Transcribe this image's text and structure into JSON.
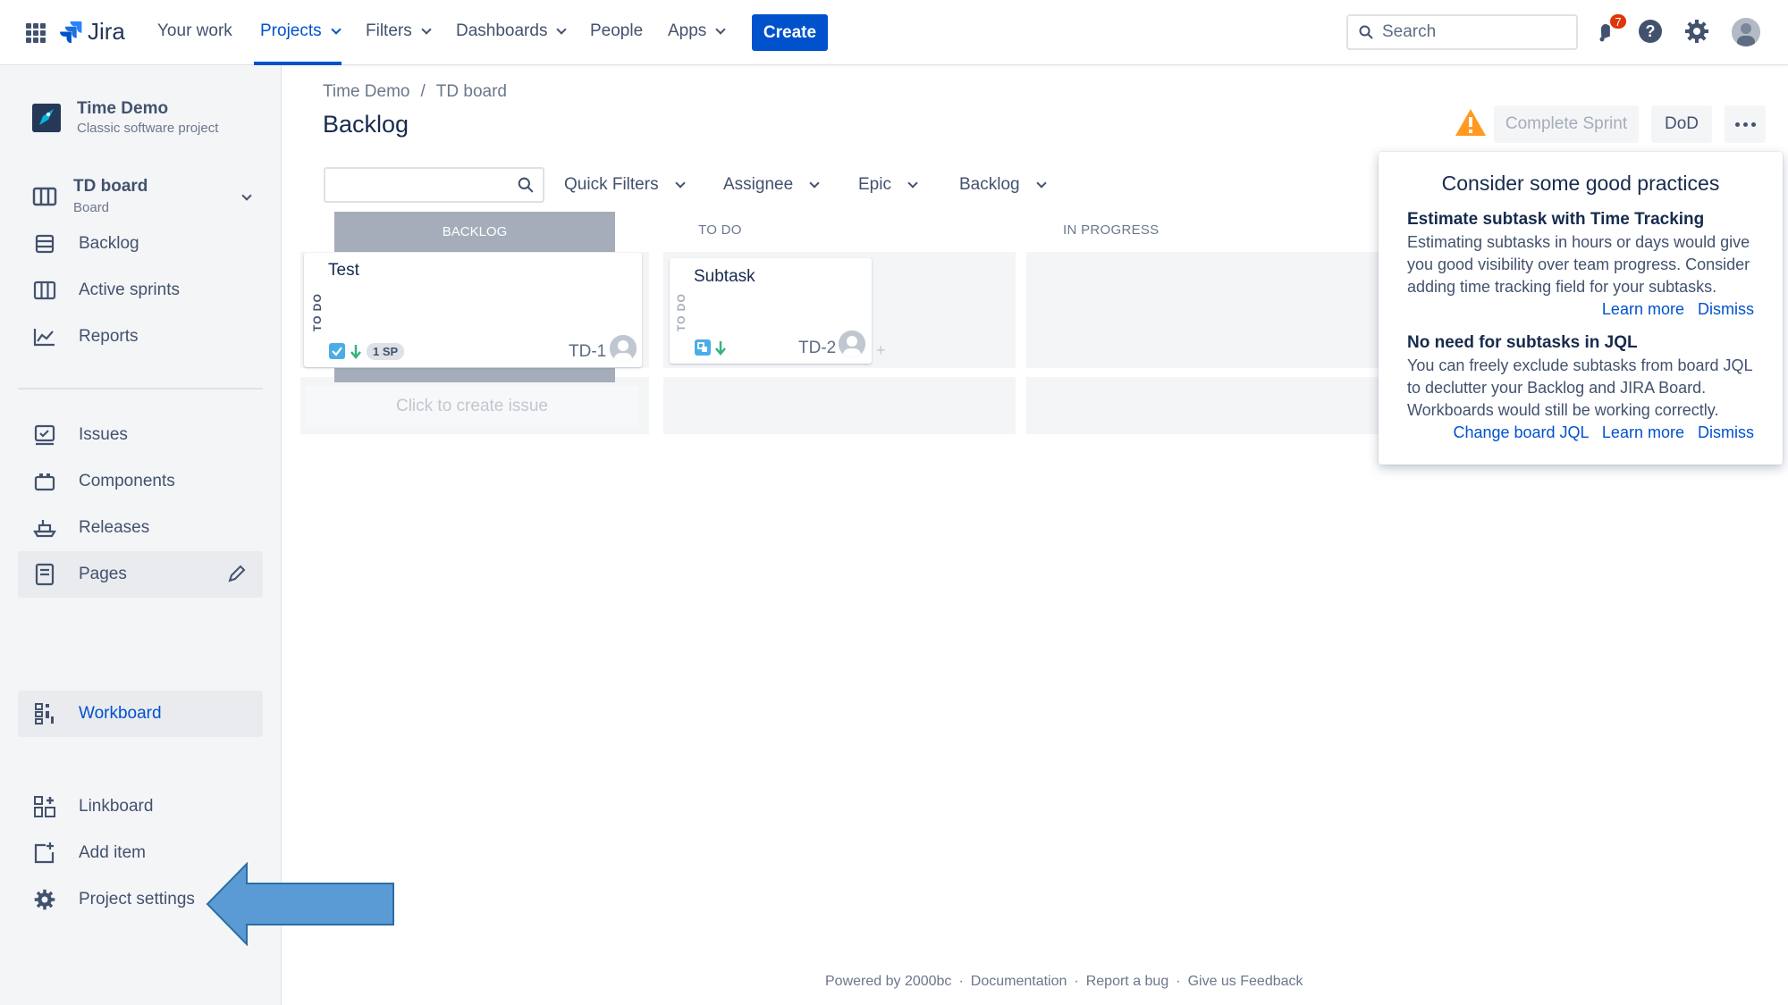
{
  "topnav": {
    "logo": "Jira",
    "items": [
      {
        "label": "Your work"
      },
      {
        "label": "Projects"
      },
      {
        "label": "Filters"
      },
      {
        "label": "Dashboards"
      },
      {
        "label": "People"
      },
      {
        "label": "Apps"
      }
    ],
    "create_label": "Create",
    "search_placeholder": "Search",
    "notification_count": "7",
    "accent": "#0052cc"
  },
  "sidebar": {
    "project_name": "Time Demo",
    "project_type": "Classic software project",
    "board_name": "TD board",
    "board_sub": "Board",
    "items": [
      {
        "label": "Backlog",
        "icon": "backlog-icon"
      },
      {
        "label": "Active sprints",
        "icon": "board-icon"
      },
      {
        "label": "Reports",
        "icon": "reports-icon"
      },
      {
        "label": "Issues",
        "icon": "issues-icon"
      },
      {
        "label": "Components",
        "icon": "components-icon"
      },
      {
        "label": "Releases",
        "icon": "releases-icon"
      },
      {
        "label": "Pages",
        "icon": "pages-icon"
      },
      {
        "label": "Workboard",
        "icon": "workboard-icon"
      },
      {
        "label": "Linkboard",
        "icon": "linkboard-icon"
      },
      {
        "label": "Add item",
        "icon": "add-item-icon"
      },
      {
        "label": "Project settings",
        "icon": "gear-icon"
      }
    ]
  },
  "main": {
    "breadcrumb": [
      "Time Demo",
      "/",
      "TD board"
    ],
    "title": "Backlog",
    "complete_sprint": "Complete Sprint",
    "dod": "DoD",
    "filters": [
      "Quick Filters",
      "Assignee",
      "Epic",
      "Backlog"
    ],
    "columns": [
      "BACKLOG",
      "TO DO",
      "IN PROGRESS"
    ],
    "cards": [
      {
        "title": "Test",
        "key": "TD-1",
        "status": "TO DO",
        "points": "1 SP"
      },
      {
        "title": "Subtask",
        "key": "TD-2",
        "status": "TO DO"
      }
    ],
    "create_issue": "Click to create issue"
  },
  "popup": {
    "title": "Consider some good practices",
    "tips": [
      {
        "title": "Estimate subtask with Time Tracking",
        "body": "Estimating subtasks in hours or days would give you good visibility over team progress. Consider adding time tracking field for your subtasks.",
        "links": [
          "Learn more",
          "Dismiss"
        ]
      },
      {
        "title": "No need for subtasks in JQL",
        "body": "You can freely exclude subtasks from board JQL to declutter your Backlog and JIRA Board. Workboards would still be working correctly.",
        "links": [
          "Change board JQL",
          "Learn more",
          "Dismiss"
        ]
      }
    ]
  },
  "footer": [
    "Powered by 2000bc",
    "·",
    "Documentation",
    "·",
    "Report a bug",
    "·",
    "Give us Feedback"
  ]
}
